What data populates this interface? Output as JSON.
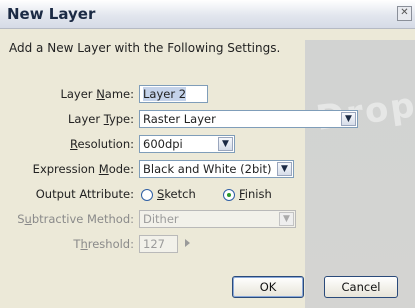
{
  "dialog": {
    "title": "New Layer",
    "close_glyph": "✕",
    "intro": "Add a New Layer with the Following Settings.",
    "watermark": "Drop"
  },
  "fields": {
    "layer_name": {
      "label_pre": "Layer ",
      "label_u": "N",
      "label_post": "ame:",
      "value": "Layer 2"
    },
    "layer_type": {
      "label_pre": "Layer ",
      "label_u": "T",
      "label_post": "ype:",
      "value": "Raster Layer"
    },
    "resolution": {
      "label_pre": "",
      "label_u": "R",
      "label_post": "esolution:",
      "value": "600dpi"
    },
    "expression_mode": {
      "label_pre": "Expression ",
      "label_u": "M",
      "label_post": "ode:",
      "value": "Black and White (2bit)"
    },
    "output_attribute": {
      "label": "Output Attribute:",
      "options": [
        {
          "pre": "",
          "u": "S",
          "post": "ketch",
          "selected": false
        },
        {
          "pre": "",
          "u": "F",
          "post": "inish",
          "selected": true
        }
      ]
    },
    "subtractive_method": {
      "label_pre": "S",
      "label_u": "u",
      "label_post": "btractive Method:",
      "value": "Dither",
      "disabled": true
    },
    "threshold": {
      "label_pre": "T",
      "label_u": "h",
      "label_post": "reshold:",
      "value": "127",
      "disabled": true
    }
  },
  "buttons": {
    "ok": "OK",
    "cancel": "Cancel"
  },
  "icons": {
    "dropdown": "chevron-down-icon",
    "close": "close-icon",
    "spin": "triangle-right-icon"
  }
}
